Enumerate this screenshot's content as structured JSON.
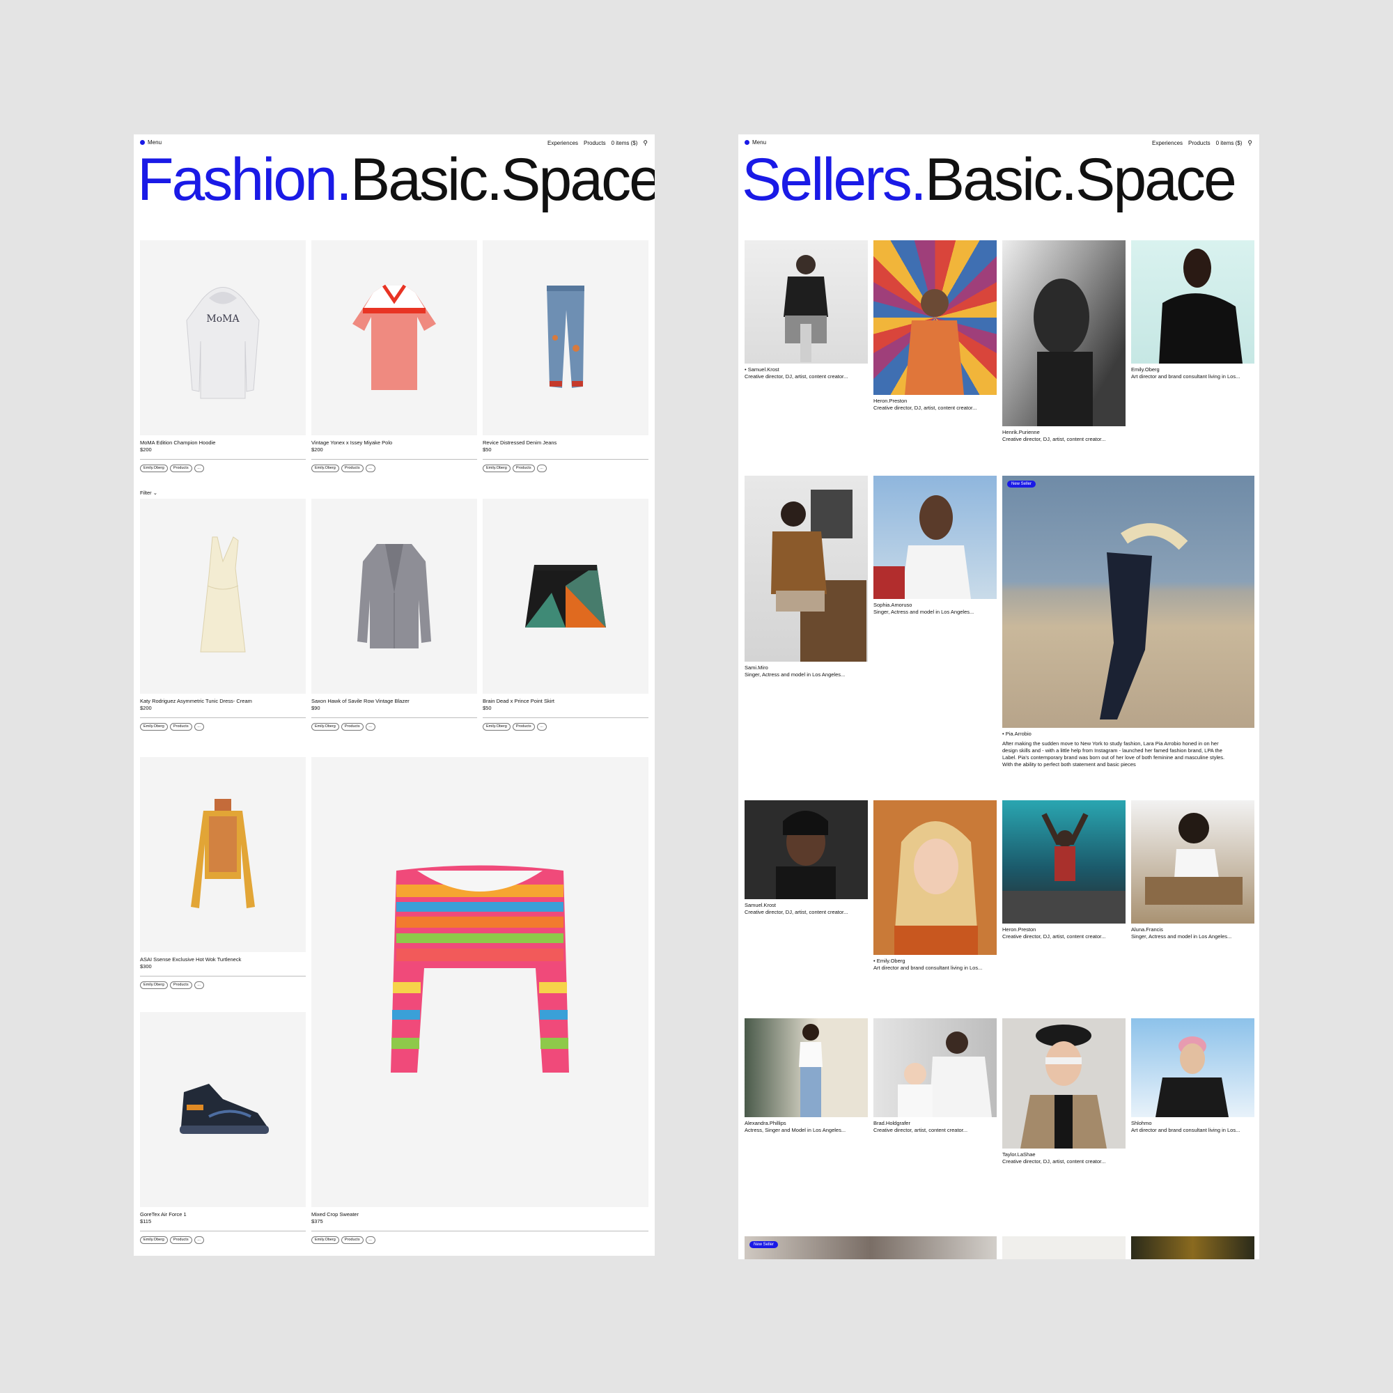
{
  "fashion": {
    "menu_label": "Menu",
    "nav": [
      "Experiences",
      "Products",
      "0 items ($)"
    ],
    "brand_accent": "Fashion.",
    "brand_rest": "Basic.Space",
    "filter_label": "Filter",
    "tags": [
      "Emily.Oberg",
      "Products",
      "..."
    ],
    "products": [
      {
        "name": "MoMA Edition Champion Hoodie",
        "price": "$200"
      },
      {
        "name": "Vintage Yonex x Issey Miyake Polo",
        "price": "$200"
      },
      {
        "name": "Revice Distressed Denim Jeans",
        "price": "$50"
      },
      {
        "name": "Katy Rodriguez Asymmetric Tunic Dress- Cream",
        "price": "$200"
      },
      {
        "name": "Saxon Hawk of Savile Row Vintage Blazer",
        "price": "$90"
      },
      {
        "name": "Brain Dead x Prince Point Skirt",
        "price": "$50"
      },
      {
        "name": "ASAI Ssense Exclusive Hot Wok Turtleneck",
        "price": "$300"
      },
      {
        "name": "GoreTex Air Force 1",
        "price": "$115"
      },
      {
        "name": "Mixed Crop Sweater",
        "price": "$375"
      }
    ],
    "hoodie_print": "MoMA"
  },
  "sellers": {
    "menu_label": "Menu",
    "nav": [
      "Experiences",
      "Products",
      "0 items ($)"
    ],
    "brand_accent": "Sellers.",
    "brand_rest": "Basic.Space",
    "badge": "New Seller",
    "people": [
      {
        "name": "• Samuel.Krost",
        "desc": "Creative director, DJ, artist, content creator..."
      },
      {
        "name": "Heron.Preston",
        "desc": "Creative director, DJ, artist, content creator..."
      },
      {
        "name": "Henrik.Purienne",
        "desc": "Creative director, DJ, artist, content creator..."
      },
      {
        "name": "Emily.Oberg",
        "desc": "Art director and brand consultant living in Los..."
      },
      {
        "name": "Sami.Miro",
        "desc": "Singer, Actress and model in Los Angeles..."
      },
      {
        "name": "Sophia.Amoruso",
        "desc": "Singer, Actress and model in Los Angeles..."
      },
      {
        "name": "• Pia.Arrobio",
        "desc": ""
      },
      {
        "name": "Samuel.Krost",
        "desc": "Creative director, DJ, artist, content creator..."
      },
      {
        "name": "• Emily.Oberg",
        "desc": "Art director and brand consultant living in Los..."
      },
      {
        "name": "Heron.Preston",
        "desc": "Creative director, DJ, artist, content creator..."
      },
      {
        "name": "Aluna.Francis",
        "desc": "Singer, Actress and model in Los Angeles..."
      },
      {
        "name": "Alexandra.Phillips",
        "desc": "Actress, Singer and Model in Los Angeles..."
      },
      {
        "name": "Brad.Holdgrafer",
        "desc": "Creative director, artist, content creator..."
      },
      {
        "name": "Taylor.LaShae",
        "desc": "Creative director, DJ, artist, content creator..."
      },
      {
        "name": "Shlohmo",
        "desc": "Art director and brand consultant living in Los..."
      }
    ],
    "pia_bio": [
      "After making the sudden move to New York to study fashion, Lara Pia Arrobio honed in on her",
      "design skills and - with a little help from Instagram - launched her famed fashion brand, LPA the",
      "Label. Pia's contemporary brand was born out of her love of both feminine and masculine styles.",
      "With the ability to perfect both statement and basic pieces"
    ]
  },
  "colors": {
    "accent": "#1a1ae6",
    "background": "#e4e4e4",
    "card": "#f4f4f4"
  }
}
